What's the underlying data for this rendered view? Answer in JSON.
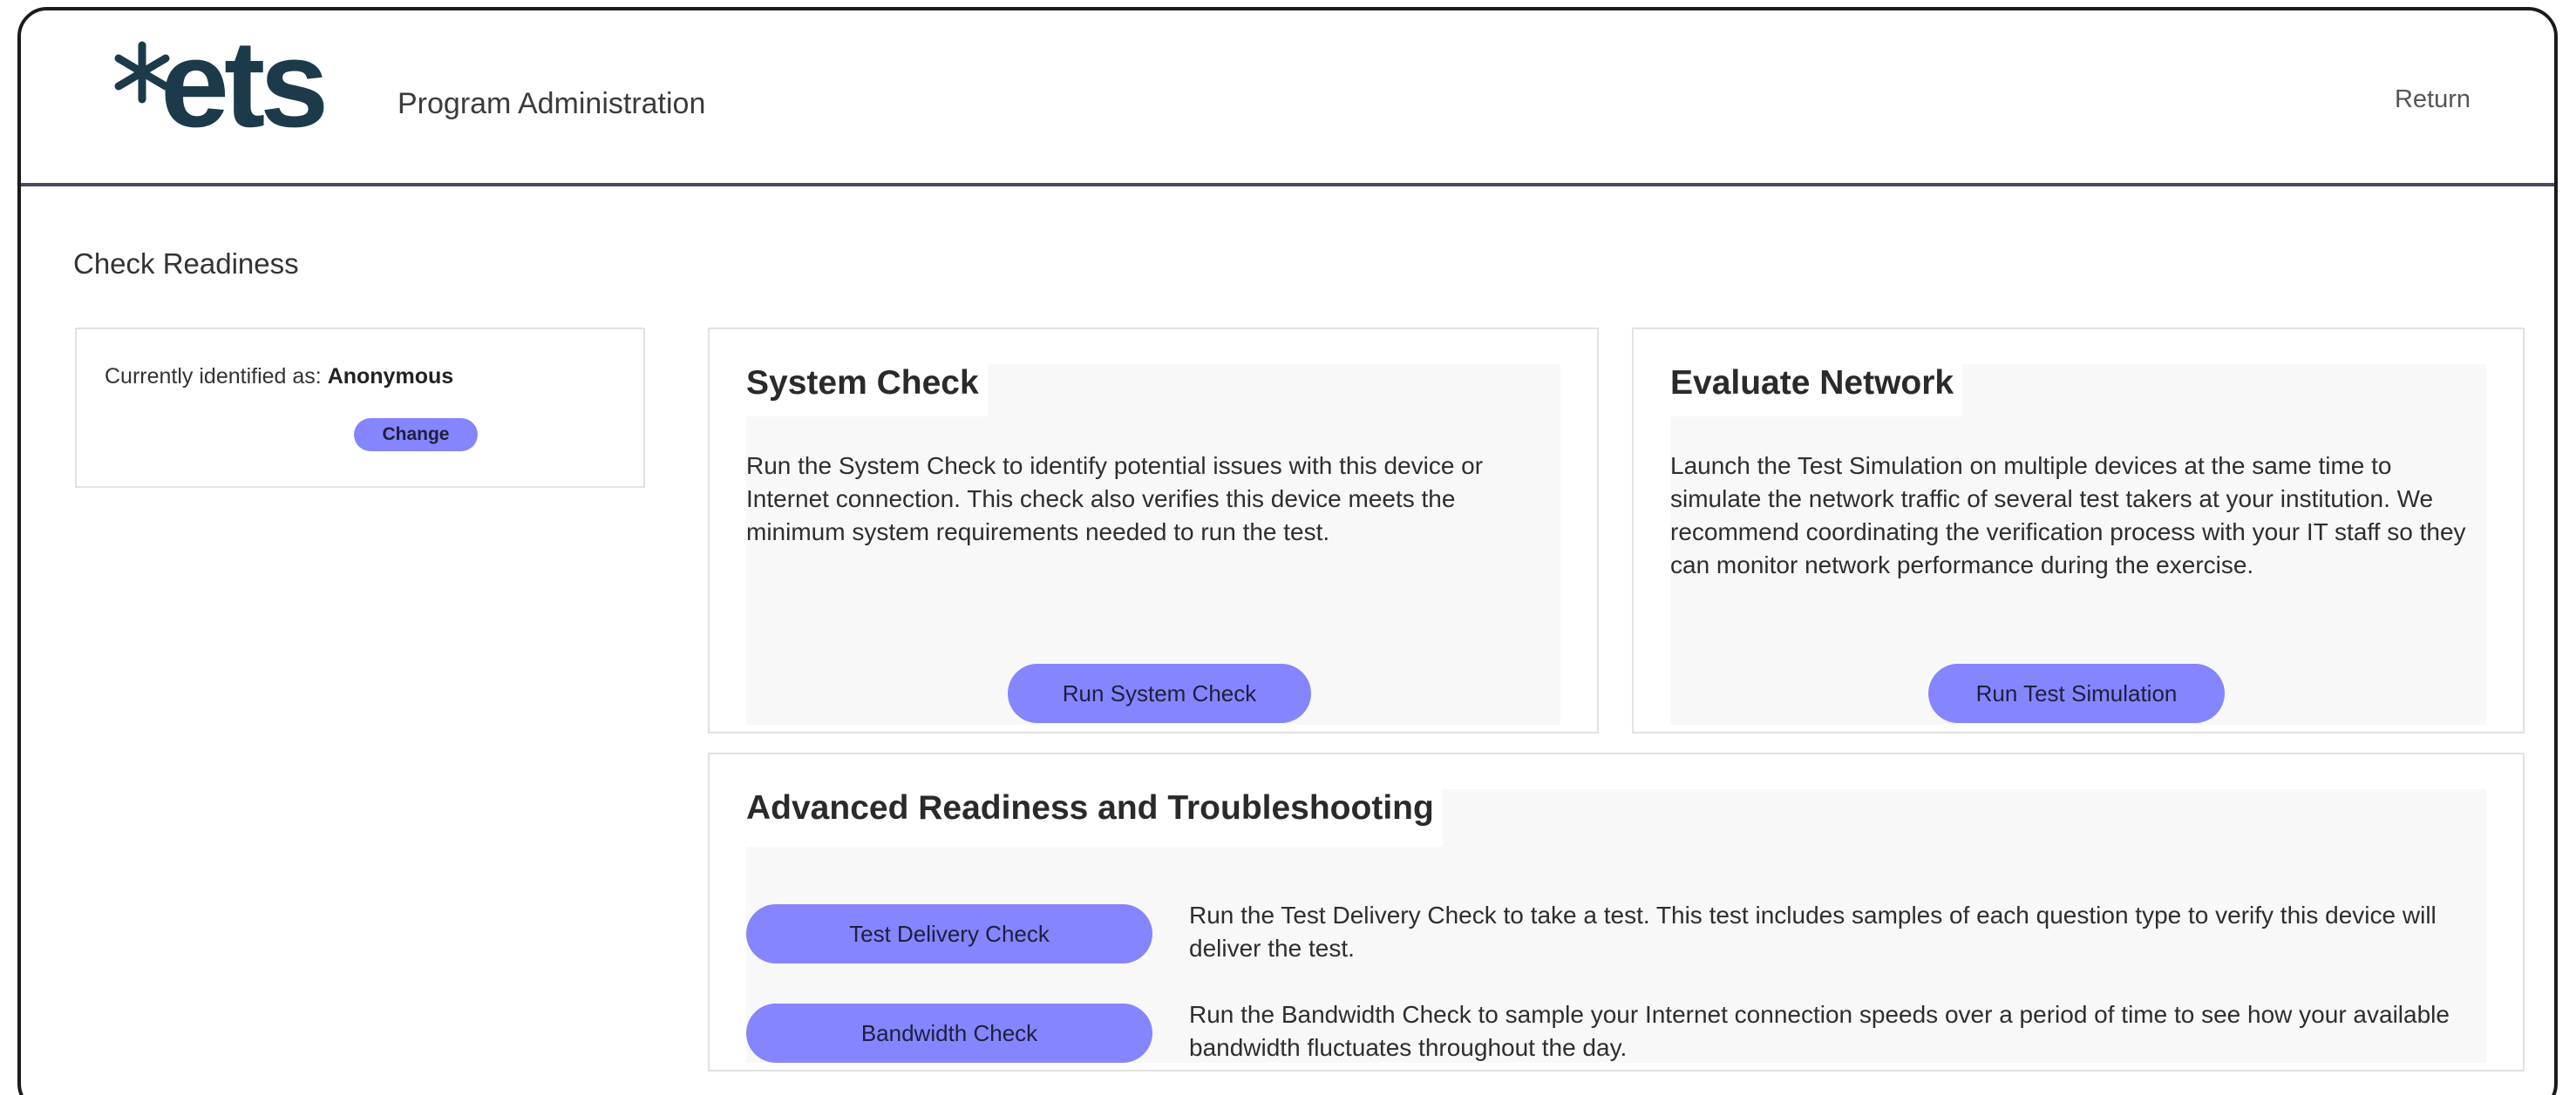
{
  "header": {
    "logo_text": "ets",
    "program_title": "Program Administration",
    "return_label": "Return"
  },
  "page_title": "Check Readiness",
  "identity": {
    "prefix": "Currently identified as:",
    "name": "Anonymous",
    "change_label": "Change"
  },
  "system_check": {
    "title": "System Check",
    "description": "Run the System Check to identify potential issues with this device or Internet connection. This check also verifies this device meets the minimum system requirements needed to run the test.",
    "button_label": "Run System Check"
  },
  "evaluate_network": {
    "title": "Evaluate Network",
    "description": "Launch the Test Simulation on multiple devices at the same time to simulate the network traffic of several test takers at your institution. We recommend coordinating the verification process with your IT staff so they can monitor network performance during the exercise.",
    "button_label": "Run Test Simulation"
  },
  "advanced": {
    "title": "Advanced Readiness and Troubleshooting",
    "items": [
      {
        "button_label": "Test Delivery Check",
        "description": "Run the Test Delivery Check to take a test. This test includes samples of each question type to verify this device will deliver the test."
      },
      {
        "button_label": "Bandwidth Check",
        "description": "Run the Bandwidth Check to sample your Internet connection speeds over a period of time to see how your available bandwidth fluctuates throughout the day."
      }
    ]
  },
  "colors": {
    "accent_button": "#8585ff",
    "logo": "#1c3a4a",
    "header_border": "#4a4760"
  },
  "icons": {
    "logo_mark": "asterisk-icon"
  }
}
